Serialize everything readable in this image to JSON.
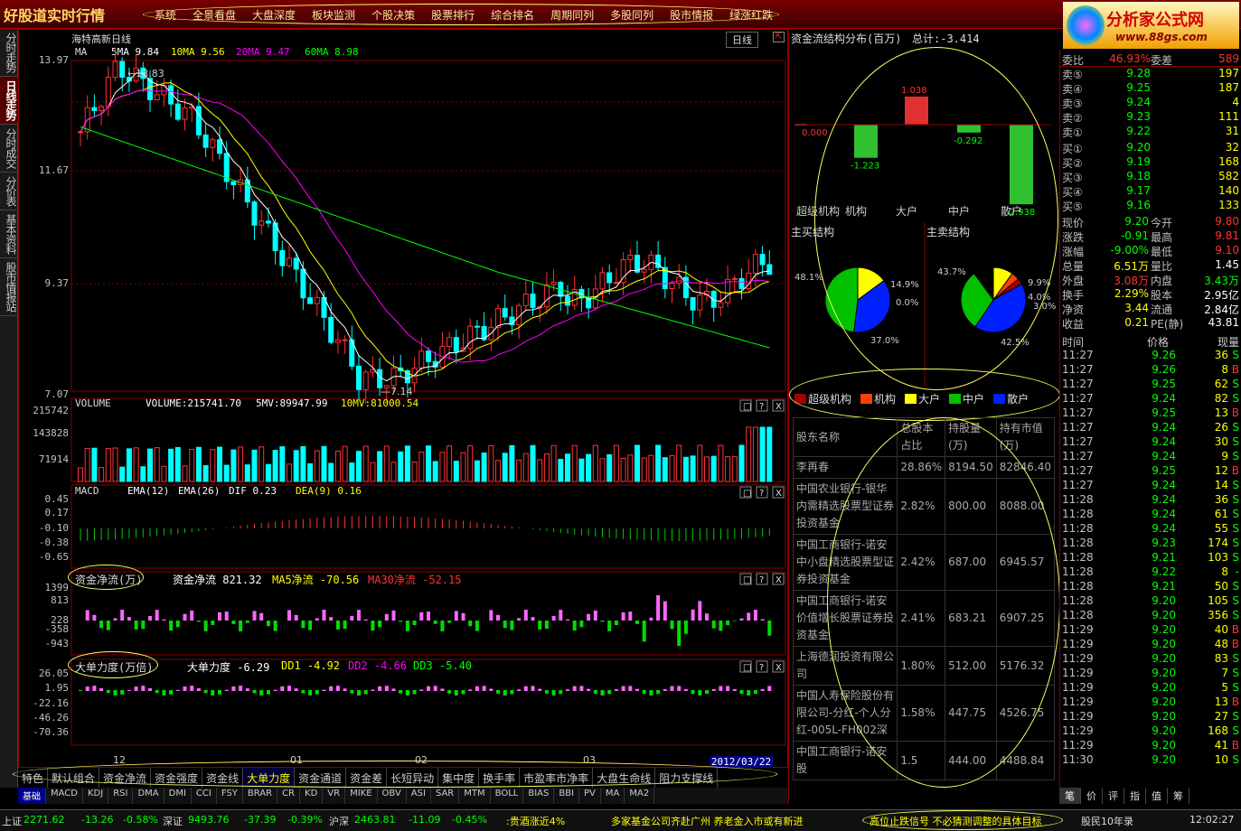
{
  "app": {
    "logo": "好股道实时行情",
    "brand": "分析家公式网",
    "brand_url": "www.88gs.com"
  },
  "menu": [
    "系统",
    "全景看盘",
    "大盘深度",
    "板块监测",
    "个股决策",
    "股票排行",
    "综合排名",
    "周期同列",
    "多股同列",
    "股市情报",
    "绿涨红跌"
  ],
  "left_tabs": [
    "分时走势",
    "日线走势",
    "分时成交",
    "分价表",
    "基本资料",
    "股市情报站"
  ],
  "left_tab_active": 1,
  "chart": {
    "title": "海特高新日线",
    "period": "日线",
    "ma": {
      "label": "MA",
      "ma5": "5MA 9.84",
      "ma10": "10MA 9.56",
      "ma20": "20MA 9.47",
      "ma60": "60MA 8.98"
    },
    "price_ticks": [
      "13.97",
      "11.67",
      "9.37",
      "7.07"
    ],
    "high_label": "13.83",
    "low_label": "7.14",
    "volume": {
      "label": "VOLUME",
      "v": "VOLUME:215741.70",
      "mv5": "5MV:89947.99",
      "mv10": "10MV:81000.54",
      "ticks": [
        "215742",
        "143828",
        "71914"
      ]
    },
    "macd": {
      "label": "MACD",
      "ema12": "EMA(12)",
      "ema26": "EMA(26)",
      "dif": "DIF 0.23",
      "dea": "DEA(9) 0.16",
      "ticks": [
        "0.45",
        "0.17",
        "-0.10",
        "-0.38",
        "-0.65"
      ]
    },
    "fund": {
      "label": "资金净流(万)",
      "v": "资金净流 821.32",
      "ma5": "MA5净流 -70.56",
      "ma30": "MA30净流 -52.15",
      "ticks": [
        "1399",
        "813",
        "228",
        "-358",
        "-943"
      ]
    },
    "big": {
      "label": "大单力度(万倍)",
      "v": "大单力度 -6.29",
      "dd1": "DD1 -4.92",
      "dd2": "DD2 -4.66",
      "dd3": "DD3 -5.40",
      "ticks": [
        "26.05",
        "1.95",
        "-22.16",
        "-46.26",
        "-70.36"
      ]
    },
    "dates": [
      "12",
      "01",
      "02",
      "03"
    ],
    "date_box": "2012/03/22"
  },
  "bottom_tabs": [
    "特色",
    "默认组合",
    "资金净流",
    "资金强度",
    "资金线",
    "大单力度",
    "资金通道",
    "资金差",
    "长短异动",
    "集中度",
    "换手率",
    "市盈率市净率",
    "大盘生命线",
    "阻力支撑线"
  ],
  "bottom_tab_active": 5,
  "sub_tabs": [
    "基础",
    "MACD",
    "KDJ",
    "RSI",
    "DMA",
    "DMI",
    "CCI",
    "FSY",
    "BRAR",
    "CR",
    "KD",
    "VR",
    "MIKE",
    "OBV",
    "ASI",
    "SAR",
    "MTM",
    "BOLL",
    "BIAS",
    "BBI",
    "PV",
    "MA",
    "MA2"
  ],
  "fund_struct": {
    "title": "资金流结构分布(百万)",
    "total": "总计:-3.414",
    "bars": [
      {
        "name": "超级机构",
        "value": "0.000"
      },
      {
        "name": "机构",
        "value": "-1.223"
      },
      {
        "name": "大户",
        "value": "1.038"
      },
      {
        "name": "中户",
        "value": "-0.292"
      },
      {
        "name": "散户",
        "value": "-2.938"
      }
    ]
  },
  "buy_struct": {
    "title": "主买结构",
    "p1": "48.1%",
    "p2": "14.9%",
    "p3": "0.0%",
    "p4": "37.0%"
  },
  "sell_struct": {
    "title": "主卖结构",
    "p1": "43.7%",
    "p2": "9.9%",
    "p3": "4.0%",
    "p4": "3.0%",
    "p5": "42.5%"
  },
  "legend": [
    "超级机构",
    "机构",
    "大户",
    "中户",
    "散户"
  ],
  "legend_colors": [
    "#a00000",
    "#ff4000",
    "#ffff00",
    "#00c000",
    "#0020ff"
  ],
  "shareholders": {
    "headers": [
      "股东名称",
      "总股本占比",
      "持股量(万)",
      "持有市值(万)"
    ],
    "rows": [
      [
        "李再春",
        "28.86%",
        "8194.50",
        "82846.40"
      ],
      [
        "中国农业银行-银华内需精选股票型证券投资基金",
        "2.82%",
        "800.00",
        "8088.00"
      ],
      [
        "中国工商银行-诺安中小盘精选股票型证券投资基金",
        "2.42%",
        "687.00",
        "6945.57"
      ],
      [
        "中国工商银行-诺安价值增长股票证券投资基金",
        "2.41%",
        "683.21",
        "6907.25"
      ],
      [
        "上海德润投资有限公司",
        "1.80%",
        "512.00",
        "5176.32"
      ],
      [
        "中国人寿保险股份有限公司-分红-个人分红-005L-FH002深",
        "1.58%",
        "447.75",
        "4526.75"
      ],
      [
        "中国工商银行-诺安股",
        "1.5",
        "444.00",
        "4488.84"
      ]
    ]
  },
  "quote": {
    "wb": "委比",
    "wb_v": "46.93%",
    "wc": "委差",
    "wc_v": "589",
    "sells": [
      [
        "卖⑤",
        "9.28",
        "197"
      ],
      [
        "卖④",
        "9.25",
        "187"
      ],
      [
        "卖③",
        "9.24",
        "4"
      ],
      [
        "卖②",
        "9.23",
        "111"
      ],
      [
        "卖①",
        "9.22",
        "31"
      ]
    ],
    "buys": [
      [
        "买①",
        "9.20",
        "32"
      ],
      [
        "买②",
        "9.19",
        "168"
      ],
      [
        "买③",
        "9.18",
        "582"
      ],
      [
        "买④",
        "9.17",
        "140"
      ],
      [
        "买⑤",
        "9.16",
        "133"
      ]
    ],
    "stats": [
      [
        "现价",
        "9.20",
        "今开",
        "9.80"
      ],
      [
        "涨跌",
        "-0.91",
        "最高",
        "9.81"
      ],
      [
        "涨幅",
        "-9.00%",
        "最低",
        "9.10"
      ],
      [
        "总量",
        "6.51万",
        "量比",
        "1.45"
      ],
      [
        "外盘",
        "3.08万",
        "内盘",
        "3.43万"
      ],
      [
        "换手",
        "2.29%",
        "股本",
        "2.95亿"
      ],
      [
        "净资",
        "3.44",
        "流通",
        "2.84亿"
      ],
      [
        "收益",
        "0.21",
        "PE(静)",
        "43.81"
      ]
    ]
  },
  "ticks_header": [
    "时间",
    "价格",
    "现量"
  ],
  "ticks": [
    [
      "11:27",
      "9.26",
      "36",
      "S"
    ],
    [
      "11:27",
      "9.26",
      "8",
      "B"
    ],
    [
      "11:27",
      "9.25",
      "62",
      "S"
    ],
    [
      "11:27",
      "9.24",
      "82",
      "S"
    ],
    [
      "11:27",
      "9.25",
      "13",
      "B"
    ],
    [
      "11:27",
      "9.24",
      "26",
      "S"
    ],
    [
      "11:27",
      "9.24",
      "30",
      "S"
    ],
    [
      "11:27",
      "9.24",
      "9",
      "S"
    ],
    [
      "11:27",
      "9.25",
      "12",
      "B"
    ],
    [
      "11:27",
      "9.24",
      "14",
      "S"
    ],
    [
      "11:28",
      "9.24",
      "36",
      "S"
    ],
    [
      "11:28",
      "9.24",
      "61",
      "S"
    ],
    [
      "11:28",
      "9.24",
      "55",
      "S"
    ],
    [
      "11:28",
      "9.23",
      "174",
      "S"
    ],
    [
      "11:28",
      "9.21",
      "103",
      "S"
    ],
    [
      "11:28",
      "9.22",
      "8",
      "-"
    ],
    [
      "11:28",
      "9.21",
      "50",
      "S"
    ],
    [
      "11:28",
      "9.20",
      "105",
      "S"
    ],
    [
      "11:28",
      "9.20",
      "356",
      "S"
    ],
    [
      "11:29",
      "9.20",
      "40",
      "B"
    ],
    [
      "11:29",
      "9.20",
      "48",
      "B"
    ],
    [
      "11:29",
      "9.20",
      "83",
      "S"
    ],
    [
      "11:29",
      "9.20",
      "7",
      "S"
    ],
    [
      "11:29",
      "9.20",
      "5",
      "S"
    ],
    [
      "11:29",
      "9.20",
      "13",
      "B"
    ],
    [
      "11:29",
      "9.20",
      "27",
      "S"
    ],
    [
      "11:29",
      "9.20",
      "168",
      "S"
    ],
    [
      "11:29",
      "9.20",
      "41",
      "B"
    ],
    [
      "11:30",
      "9.20",
      "10",
      "S"
    ]
  ],
  "right_tabs": [
    "笔",
    "价",
    "评",
    "指",
    "值",
    "筹"
  ],
  "status": {
    "sh": "上证",
    "sh_v": "2271.62",
    "sh_c": "-13.26",
    "sh_p": "-0.58%",
    "sz": "深证",
    "sz_v": "9493.76",
    "sz_c": "-37.39",
    "sz_p": "-0.39%",
    "hs": "沪深",
    "hs_v": "2463.81",
    "hs_c": "-11.09",
    "hs_p": "-0.45%",
    "news1": ":贵酒涨近4%",
    "news2": "多家基金公司齐赴广州 养老金入市或有新进",
    "news3": "高位止跌信号 不必猜测调整的具体目标",
    "user": "股民10年录",
    "time": "12:02:27"
  },
  "colors": {
    "up": "#ff3030",
    "down": "#00ffff",
    "ma5": "#ffffff",
    "ma10": "#ffff00",
    "ma20": "#ff00ff",
    "ma60": "#00ff00",
    "frame": "#800000"
  }
}
